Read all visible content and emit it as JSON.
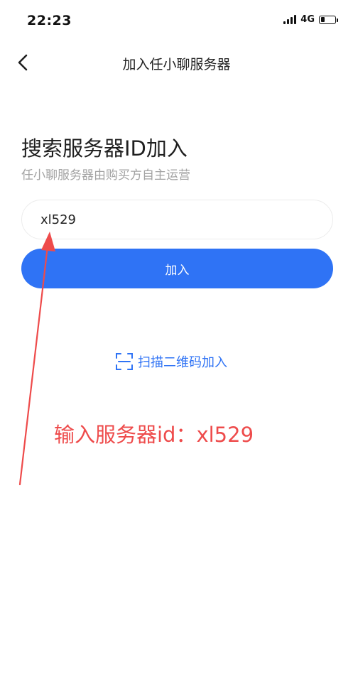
{
  "status_bar": {
    "time": "22:23",
    "network": "4G"
  },
  "nav": {
    "title": "加入任小聊服务器",
    "back_icon": "chevron-left-icon"
  },
  "heading": {
    "title": "搜索服务器ID加入",
    "subtitle": "任小聊服务器由购买方自主运营"
  },
  "server_input": {
    "value": "xl529"
  },
  "join_button": {
    "label": "加入"
  },
  "scan_qr": {
    "label": "扫描二维码加入",
    "icon": "scan-qr-icon"
  },
  "annotation": {
    "text": "输入服务器id：xl529"
  },
  "colors": {
    "primary": "#2f73f5",
    "annotation": "#ee4b4b",
    "subtitle": "#a3a3a3"
  }
}
